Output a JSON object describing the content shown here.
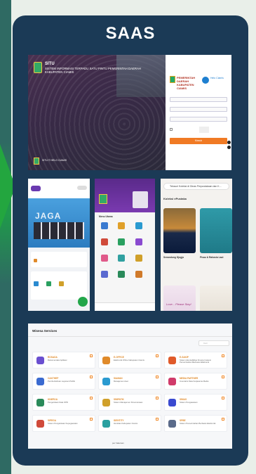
{
  "header": {
    "title": "SAAS"
  },
  "situ": {
    "app_name": "SITU",
    "app_subtitle": "SISTEM INFORMASI TERPADU SATU PINTU PEMERINTAH DAERAH KABUPATEN CIAMIS",
    "footer": "SITU © HELO CIAMIS",
    "logo_text": "PEMERINTAH DAERAH KABUPATEN CIAMIS",
    "partner_text": "Helo Ciamis",
    "login_button": "Masuk"
  },
  "ppid": {
    "app_name": "PPID",
    "banner_text": "JAGA"
  },
  "portal": {
    "menu_title": "Menu Utama"
  },
  "epustaka": {
    "search_placeholder": "Telusuri Koleksi di Dinas Perpustakaan dan K...",
    "section_title": "Koleksi ePustaka",
    "book1_title": "Senandung Djogja",
    "book2_title": "Pisau & Rahasia Laut",
    "book3_title": "Love... Please Stay!"
  },
  "services": {
    "title": "Wisesa Services",
    "search_placeholder": "Cari",
    "items": [
      {
        "name": "ROSADA",
        "desc": "Rekomendasi Aplikasi",
        "color": "#6a4fd0"
      },
      {
        "name": "E-OFFICE",
        "desc": "Elektronik Office Kabupaten Ciamis",
        "color": "#e08a2a"
      },
      {
        "name": "E-SAKIP",
        "desc": "Sistem Akuntabilitas Kinerja Instansi Pemerintahan Berbasis Elektronik",
        "color": "#e05a2a"
      },
      {
        "name": "CAKTHEP",
        "desc": "Pemberitahuan Layanan Publik",
        "color": "#3a6ad0"
      },
      {
        "name": "SIAMAN",
        "desc": "Manajemen Aset",
        "color": "#2a9ad0"
      },
      {
        "name": "MEDIA PARTNER",
        "desc": "Inventaris Data Kerjasama Media",
        "color": "#d03a6a"
      },
      {
        "name": "KINERJA",
        "desc": "Pengelolaan Data OPD",
        "color": "#2a8a5a"
      },
      {
        "name": "SIMPATIK",
        "desc": "Sistem Manajemen Perencanaan",
        "color": "#d0a02a"
      },
      {
        "name": "SIMAS",
        "desc": "Sistem Pengawasan",
        "color": "#3a4ad0"
      },
      {
        "name": "SIPEGA",
        "desc": "Sistem Pengelolaan Kepegawaian",
        "color": "#d04a3a"
      },
      {
        "name": "IDENTITY",
        "desc": "Identitas Kabupaten Ciamis",
        "color": "#2aa0a0"
      },
      {
        "name": "SPBE",
        "desc": "Sistem Pemerintahan Berbasis Elektronik",
        "color": "#5a6a8a"
      }
    ],
    "pager": "per halaman"
  }
}
